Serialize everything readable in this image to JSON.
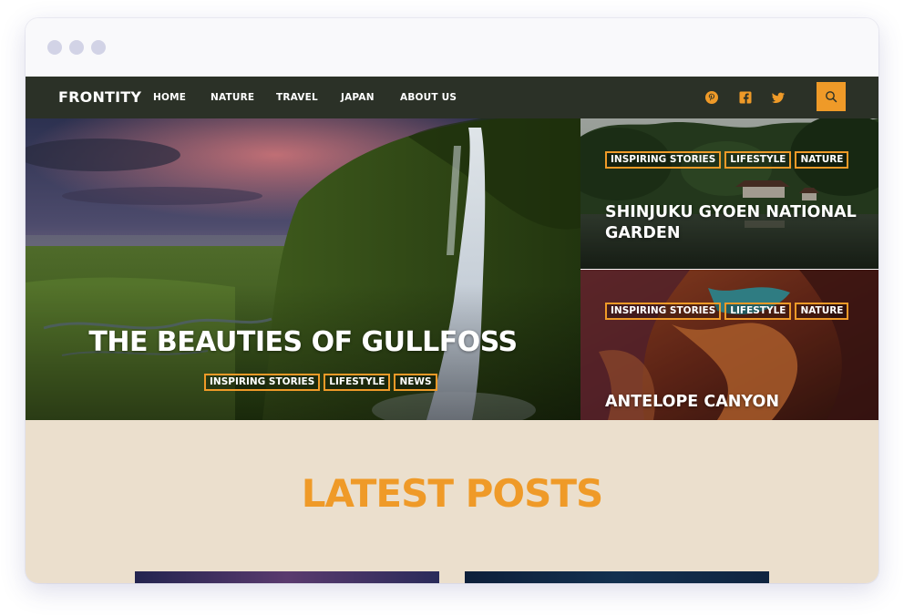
{
  "brand": {
    "accent": "#ef9a28",
    "nav_bg": "#2b3127",
    "latest_bg": "#ebdfcd"
  },
  "site": {
    "logo": "FRONTITY"
  },
  "nav": {
    "items": [
      {
        "label": "HOME"
      },
      {
        "label": "NATURE"
      },
      {
        "label": "TRAVEL"
      },
      {
        "label": "JAPAN"
      },
      {
        "label": "ABOUT US"
      }
    ]
  },
  "social": {
    "icons": [
      "pinterest-icon",
      "facebook-icon",
      "twitter-icon"
    ]
  },
  "search": {
    "icon": "search-icon"
  },
  "hero": {
    "title": "THE BEAUTIES OF GULLFOSS",
    "tags": [
      "INSPIRING STORIES",
      "LIFESTYLE",
      "NEWS"
    ]
  },
  "side_posts": [
    {
      "title": "SHINJUKU GYOEN NATIONAL GARDEN",
      "tags": [
        "INSPIRING STORIES",
        "LIFESTYLE",
        "NATURE"
      ]
    },
    {
      "title": "ANTELOPE CANYON",
      "tags": [
        "INSPIRING STORIES",
        "LIFESTYLE",
        "NATURE"
      ]
    }
  ],
  "latest": {
    "title": "LATEST POSTS"
  }
}
